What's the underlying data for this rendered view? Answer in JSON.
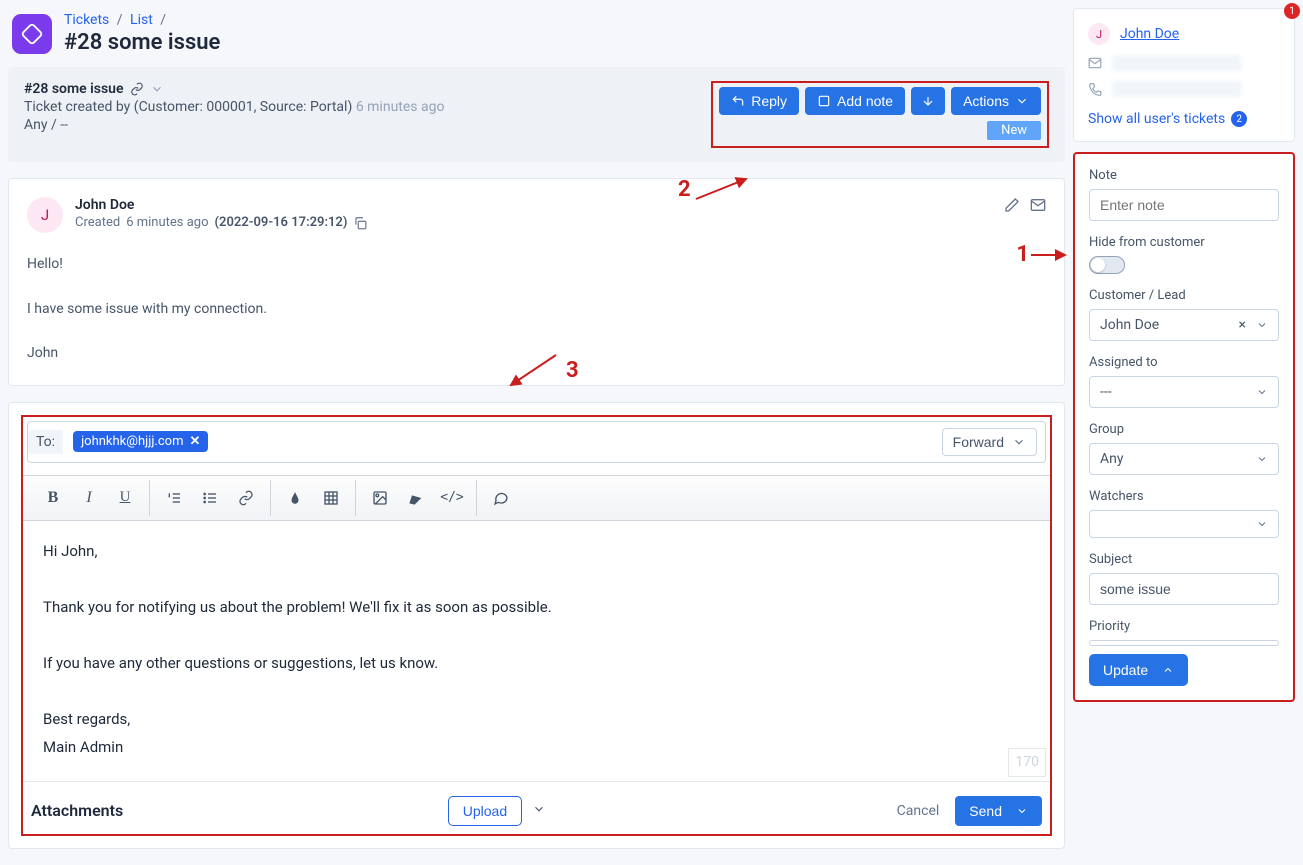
{
  "colors": {
    "accent": "#2573e5",
    "danger": "#c81e1e"
  },
  "breadcrumb": {
    "tickets": "Tickets",
    "list": "List"
  },
  "page_title": "#28 some issue",
  "ticket_bar": {
    "title": "#28 some issue",
    "created_prefix": "Ticket created by (",
    "created_customer": "Customer: 000001, Source: Portal",
    "created_suffix": ")",
    "time_ago": "6 minutes ago",
    "status": "Any / --",
    "reply": "Reply",
    "add_note": "Add note",
    "actions": "Actions",
    "new_badge": "New"
  },
  "annotations": {
    "one": "1",
    "two": "2",
    "three": "3"
  },
  "message": {
    "author": "John Doe",
    "avatar_initial": "J",
    "created_prefix": "Created",
    "created_ago": "6 minutes ago",
    "timestamp": "(2022-09-16 17:29:12)",
    "body_line1": "Hello!",
    "body_line2": "I have some issue with my connection.",
    "body_line3": "John"
  },
  "reply": {
    "to_label": "To:",
    "recipient": "johnkhk@hjjj.com",
    "forward": "Forward",
    "body": {
      "l1": "Hi John,",
      "l2": "Thank you for notifying us about the problem! We'll fix it as soon as possible.",
      "l3": "If you have any other questions or suggestions, let us know.",
      "l4": "Best regards,",
      "l5": "Main Admin"
    },
    "char_count": "170",
    "attachments": "Attachments",
    "upload": "Upload",
    "cancel": "Cancel",
    "send": "Send"
  },
  "sidebar": {
    "notif_count": "1",
    "user_name": "John Doe",
    "user_initial": "J",
    "show_tickets": "Show all user's tickets",
    "tickets_count": "2",
    "note_label": "Note",
    "note_placeholder": "Enter note",
    "hide_label": "Hide from customer",
    "customer_label": "Customer / Lead",
    "customer_value": "John Doe",
    "assigned_label": "Assigned to",
    "assigned_value": "---",
    "group_label": "Group",
    "group_value": "Any",
    "watchers_label": "Watchers",
    "watchers_value": "",
    "subject_label": "Subject",
    "subject_value": "some issue",
    "priority_label": "Priority",
    "update": "Update"
  }
}
